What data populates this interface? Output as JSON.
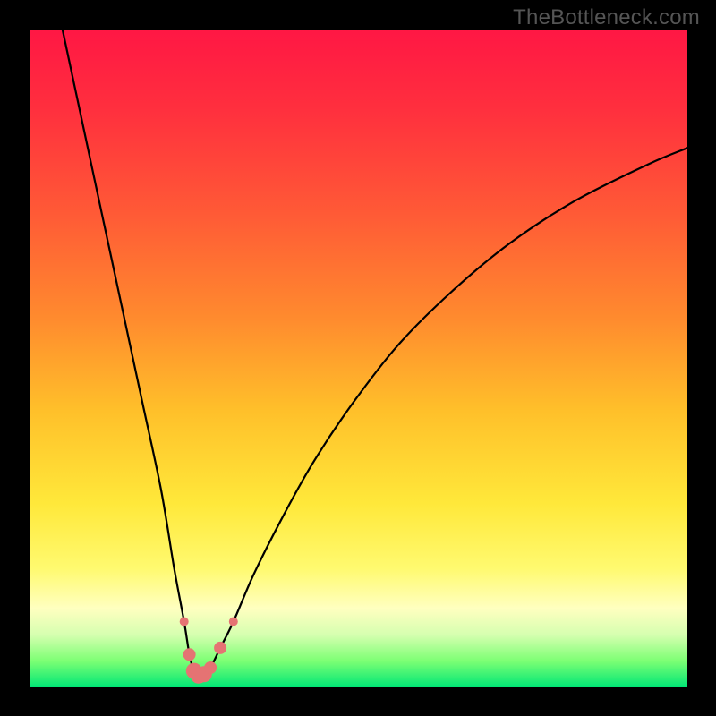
{
  "watermark": "TheBottleneck.com",
  "colors": {
    "gradient_top": "#ff1744",
    "gradient_mid": "#ffe83a",
    "gradient_bottom": "#00e676",
    "curve": "#000000",
    "marker": "#e57373",
    "frame": "#000000"
  },
  "chart_data": {
    "type": "line",
    "title": "",
    "xlabel": "",
    "ylabel": "",
    "xlim": [
      0,
      100
    ],
    "ylim": [
      0,
      100
    ],
    "grid": false,
    "legend": false,
    "series": [
      {
        "name": "bottleneck-curve",
        "x": [
          5,
          8,
          11,
          14,
          17,
          20,
          22,
          23.5,
          24.3,
          25,
          25.7,
          26.5,
          27.5,
          29,
          31,
          34,
          38,
          43,
          49,
          56,
          64,
          73,
          83,
          94,
          100
        ],
        "y": [
          100,
          86,
          72,
          58,
          44,
          30,
          18,
          10,
          5,
          2.5,
          1.8,
          2.0,
          3.0,
          6,
          10,
          17,
          25,
          34,
          43,
          52,
          60,
          67.5,
          74,
          79.5,
          82
        ]
      }
    ],
    "markers": [
      {
        "x": 23.5,
        "y": 10,
        "size": "small"
      },
      {
        "x": 24.3,
        "y": 5,
        "size": "medium"
      },
      {
        "x": 25.0,
        "y": 2.5,
        "size": "large"
      },
      {
        "x": 25.7,
        "y": 1.8,
        "size": "large"
      },
      {
        "x": 26.5,
        "y": 2.0,
        "size": "large"
      },
      {
        "x": 27.5,
        "y": 3.0,
        "size": "medium"
      },
      {
        "x": 29.0,
        "y": 6.0,
        "size": "medium"
      },
      {
        "x": 31.0,
        "y": 10.0,
        "size": "small"
      }
    ],
    "notes": "x and y are percentage-of-plot-area coordinates estimated from unlabeled axes; y=0 at bottom, y=100 at top. Curve dips to near-zero around x≈26 and rises asymptotically toward y≈82 at the right edge."
  }
}
